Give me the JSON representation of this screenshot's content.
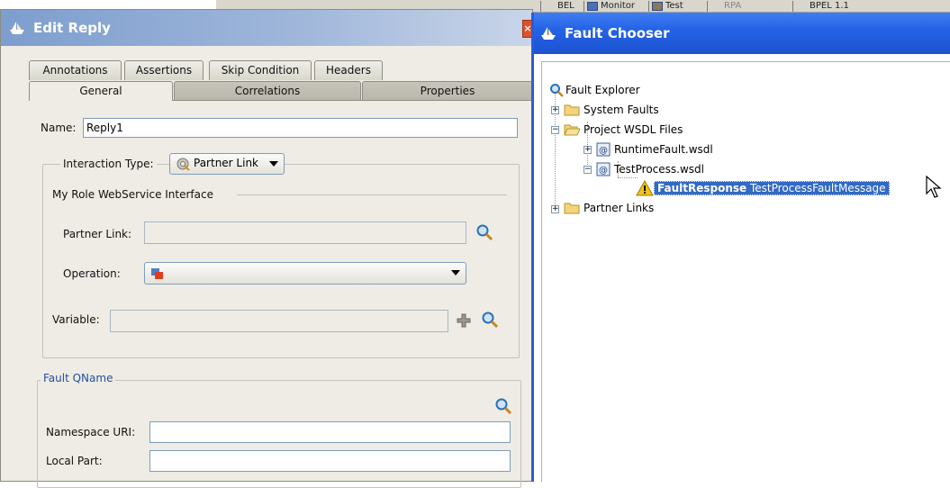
{
  "background": {
    "tabs": [
      "BEL",
      "Monitor",
      "Test",
      "RPA",
      "BPEL 1.1"
    ]
  },
  "edit_reply": {
    "title": "Edit Reply",
    "tabs_back": [
      "Annotations",
      "Assertions",
      "Skip Condition",
      "Headers"
    ],
    "tabs_front": [
      "General",
      "Correlations",
      "Properties"
    ],
    "name_label": "Name:",
    "name_value": "Reply1",
    "interaction_type_label": "Interaction Type:",
    "interaction_type_value": "Partner Link",
    "my_role_label": "My Role WebService Interface",
    "partner_link_label": "Partner Link:",
    "partner_link_value": "",
    "operation_label": "Operation:",
    "operation_value": "",
    "variable_label": "Variable:",
    "variable_value": "",
    "fault_qname_label": "Fault QName",
    "namespace_uri_label": "Namespace URI:",
    "namespace_uri_value": "",
    "local_part_label": "Local Part:",
    "local_part_value": ""
  },
  "fault_chooser": {
    "title": "Fault Chooser",
    "tree": {
      "root": "Fault Explorer",
      "system_faults": "System Faults",
      "project_wsdl_files": "Project WSDL Files",
      "runtime_fault": "RuntimeFault.wsdl",
      "test_process": "TestProcess.wsdl",
      "fault_response_name": "FaultResponse",
      "fault_response_message": "TestProcessFaultMessage",
      "partner_links": "Partner Links"
    }
  },
  "colors": {
    "selection": "#316ac5",
    "xp_title_blue": "#2563e6",
    "edit_title": "#7d9ece",
    "dialog_bg": "#eeece4"
  }
}
